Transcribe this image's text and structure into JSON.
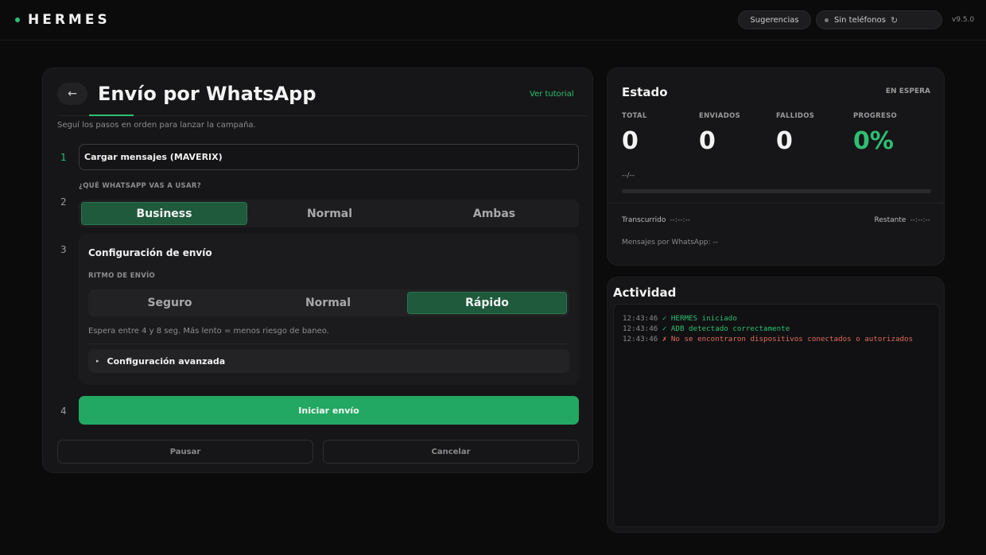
{
  "topbar": {
    "brand": "HERMES",
    "suggestions_label": "Sugerencias",
    "phones_label": "Sin teléfonos",
    "refresh_glyph": "↻",
    "version": "v9.5.0"
  },
  "main": {
    "back_glyph": "←",
    "title": "Envío por WhatsApp",
    "tutorial_link": "Ver tutorial",
    "subtitle": "Seguí los pasos en orden para lanzar la campaña.",
    "steps": [
      "1",
      "2",
      "3",
      "4"
    ],
    "load_button": "Cargar mensajes (MAVERIX)",
    "question": "¿QUÉ WHATSAPP VAS A USAR?",
    "whatsapp_options": [
      "Business",
      "Normal",
      "Ambas"
    ],
    "whatsapp_selected": "Business",
    "config": {
      "title": "Configuración de envío",
      "rhythm_label": "RITMO DE ENVÍO",
      "rhythm_options": [
        "Seguro",
        "Normal",
        "Rápido"
      ],
      "rhythm_selected": "Rápido",
      "wait_text": "Espera entre 4 y 8 seg. Más lento = menos riesgo de baneo.",
      "advanced_label": "Configuración avanzada",
      "advanced_glyph": "▸"
    },
    "start_button": "Iniciar envío",
    "pause_button": "Pausar",
    "cancel_button": "Cancelar"
  },
  "estado": {
    "title": "Estado",
    "status": "EN ESPERA",
    "stats": {
      "total_label": "TOTAL",
      "total_value": "0",
      "sent_label": "ENVIADOS",
      "sent_value": "0",
      "failed_label": "FALLIDOS",
      "failed_value": "0",
      "progress_label": "PROGRESO",
      "progress_value": "0%"
    },
    "progress_fraction": 0,
    "eta": "--/--",
    "elapsed_label": "Transcurrido",
    "elapsed_value": "--:--:--",
    "remaining_label": "Restante",
    "remaining_value": "--:--:--",
    "per_whatsapp": "Mensajes por WhatsApp: --"
  },
  "actividad": {
    "title": "Actividad",
    "logs": [
      {
        "time": "12:43:46",
        "text": "✓ HERMES iniciado",
        "kind": "ok"
      },
      {
        "time": "12:43:46",
        "text": "✓ ADB detectado correctamente",
        "kind": "ok"
      },
      {
        "time": "12:43:46",
        "text": "✗ No se encontraron dispositivos conectados o autorizados",
        "kind": "err"
      }
    ]
  },
  "colors": {
    "accent": "#2fbf71",
    "start_button": "#22a862",
    "selected_segment": "#1f5a3c",
    "error": "#e06a5a"
  }
}
